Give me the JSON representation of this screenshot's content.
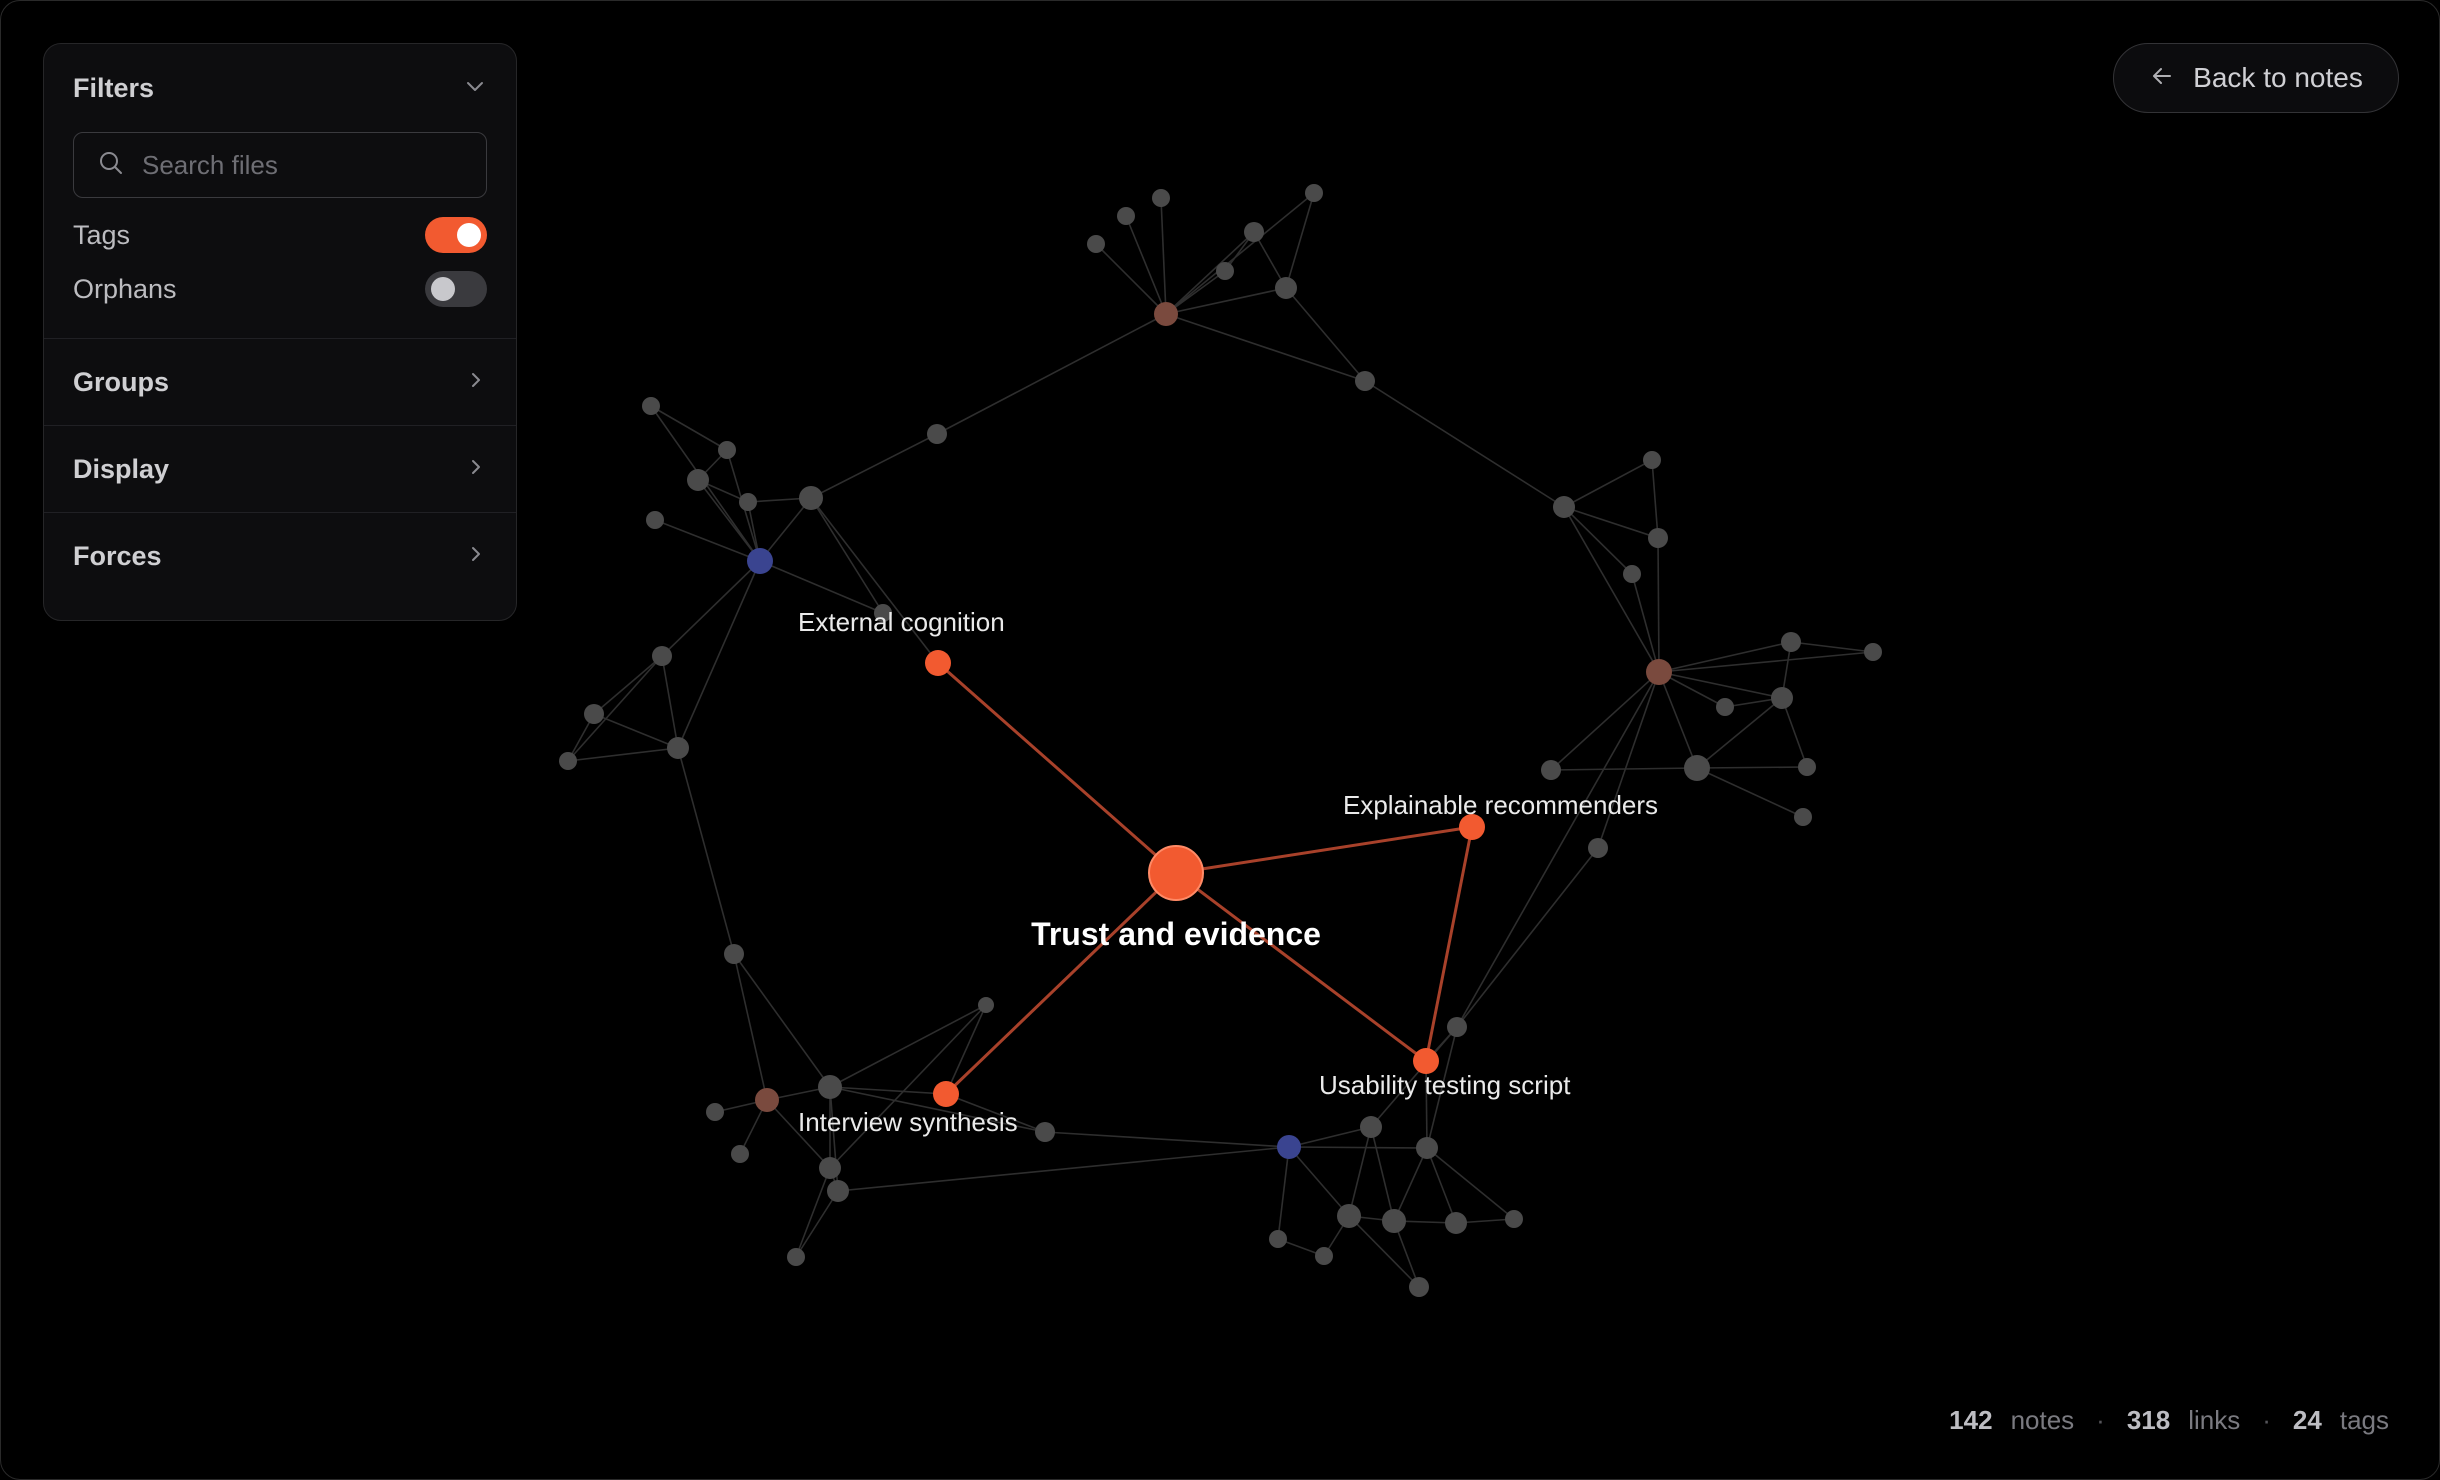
{
  "filters": {
    "title": "Filters",
    "search_placeholder": "Search files",
    "toggles": [
      {
        "label": "Tags",
        "on": true
      },
      {
        "label": "Orphans",
        "on": false
      }
    ],
    "sections": [
      "Groups",
      "Display",
      "Forces"
    ]
  },
  "back_button": {
    "label": "Back to notes"
  },
  "stats": {
    "notes_count": "142",
    "notes_label": "notes",
    "links_count": "318",
    "links_label": "links",
    "tags_count": "24",
    "tags_label": "tags",
    "separator": "·"
  },
  "graph": {
    "center": {
      "label": "Trust and evidence"
    },
    "linked_notes": [
      {
        "label": "External cognition"
      },
      {
        "label": "Explainable recommenders"
      },
      {
        "label": "Usability testing script"
      },
      {
        "label": "Interview synthesis"
      }
    ],
    "colors": {
      "accent": "#f25a30",
      "active_link": "#a8412a",
      "node": "#4a4a4a",
      "edge": "#2e2e2e",
      "tag_node": "#7a4a3e",
      "group_node": "#3a4490"
    }
  }
}
